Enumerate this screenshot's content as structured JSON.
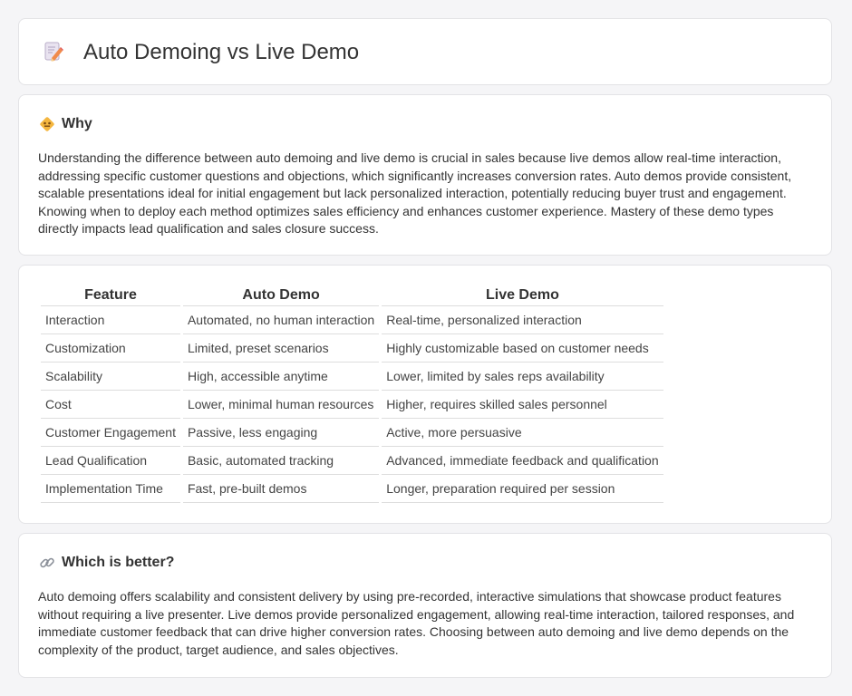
{
  "header": {
    "title": "Auto Demoing vs Live Demo",
    "icon": "document-pen-icon"
  },
  "why": {
    "heading": "Why",
    "icon": "diamond-warning-icon",
    "text": "Understanding the difference between auto demoing and live demo is crucial in sales because live demos allow real-time interaction, addressing specific customer questions and objections, which significantly increases conversion rates. Auto demos provide consistent, scalable presentations ideal for initial engagement but lack personalized interaction, potentially reducing buyer trust and engagement. Knowing when to deploy each method optimizes sales efficiency and enhances customer experience. Mastery of these demo types directly impacts lead qualification and sales closure success."
  },
  "comparison": {
    "columns": [
      "Feature",
      "Auto Demo",
      "Live Demo"
    ],
    "rows": [
      [
        "Interaction",
        "Automated, no human interaction",
        "Real-time, personalized interaction"
      ],
      [
        "Customization",
        "Limited, preset scenarios",
        "Highly customizable based on customer needs"
      ],
      [
        "Scalability",
        "High, accessible anytime",
        "Lower, limited by sales reps availability"
      ],
      [
        "Cost",
        "Lower, minimal human resources",
        "Higher, requires skilled sales personnel"
      ],
      [
        "Customer Engagement",
        "Passive, less engaging",
        "Active, more persuasive"
      ],
      [
        "Lead Qualification",
        "Basic, automated tracking",
        "Advanced, immediate feedback and qualification"
      ],
      [
        "Implementation Time",
        "Fast, pre-built demos",
        "Longer, preparation required per session"
      ]
    ]
  },
  "better": {
    "heading": "Which is better?",
    "icon": "link-icon",
    "text": "Auto demoing offers scalability and consistent delivery by using pre-recorded, interactive simulations that showcase product features without requiring a live presenter. Live demos provide personalized engagement, allowing real-time interaction, tailored responses, and immediate customer feedback that can drive higher conversion rates. Choosing between auto demoing and live demo depends on the complexity of the product, target audience, and sales objectives."
  },
  "colors": {
    "background": "#f5f5f7",
    "card": "#ffffff",
    "text": "#333333",
    "accent": "#f4b63f"
  }
}
